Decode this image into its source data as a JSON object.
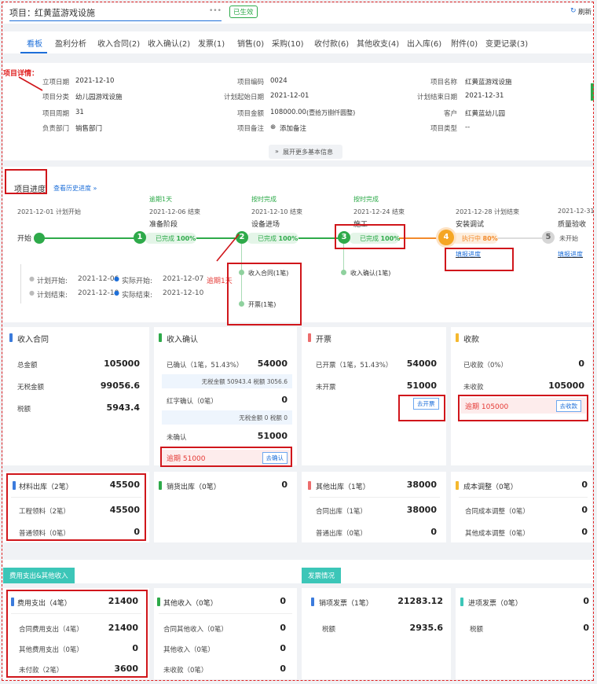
{
  "header": {
    "project_label": "项目：",
    "project_name": "红黄蓝游戏设施",
    "more": "•••",
    "status_badge": "已生效",
    "refresh": "刷新"
  },
  "tabs": [
    "看板",
    "盈利分析",
    "收入合同(2)",
    "收入确认(2)",
    "发票(1)",
    "销售(0)",
    "采购(10)",
    "收付款(6)",
    "其他收支(4)",
    "出入库(6)",
    "附件(0)",
    "变更记录(3)"
  ],
  "details": {
    "annotation": "项目详情：",
    "col1": [
      {
        "label": "立项日期",
        "value": "2021-12-10"
      },
      {
        "label": "项目分类",
        "value": "幼儿园游戏设施"
      },
      {
        "label": "项目周期",
        "value": "31"
      },
      {
        "label": "负责部门",
        "value": "销售部门"
      }
    ],
    "col2": [
      {
        "label": "项目编码",
        "value": "0024"
      },
      {
        "label": "计划起始日期",
        "value": "2021-12-01"
      },
      {
        "label": "项目金额",
        "value": "108000.00",
        "suffix": "(壹拾万捌仟圆整)"
      },
      {
        "label": "项目备注",
        "value": "添加备注"
      }
    ],
    "col3": [
      {
        "label": "项目名称",
        "value": "红黄蓝游戏设施"
      },
      {
        "label": "计划结束日期",
        "value": "2021-12-31"
      },
      {
        "label": "客户",
        "value": "红黄蓝幼儿园"
      },
      {
        "label": "项目类型",
        "value": "--"
      }
    ],
    "expand": "展开更多基本信息"
  },
  "progress": {
    "title": "项目进度",
    "history_link": "查看历史进度 »",
    "start_label": "开始",
    "start_date": "2021-12-01 计划开始",
    "stages": [
      {
        "num": "1",
        "top": "逾期1天",
        "date": "2021-12-06 结束",
        "name": "准备阶段",
        "state": "已完成",
        "pct": "100%"
      },
      {
        "num": "2",
        "top": "按时完成",
        "date": "2021-12-10 结束",
        "name": "设备进场",
        "state": "已完成",
        "pct": "100%"
      },
      {
        "num": "3",
        "top": "按时完成",
        "date": "2021-12-24 结束",
        "name": "施工",
        "state": "已完成",
        "pct": "100%"
      },
      {
        "num": "4",
        "top": "",
        "date": "2021-12-28 计划结束",
        "name": "安装调试",
        "state": "执行中",
        "pct": "80%",
        "link": "填报进度"
      },
      {
        "num": "5",
        "top": "",
        "date": "2021-12-31",
        "name": "质量验收",
        "state": "未开始",
        "pct": "",
        "link": "填报进度"
      }
    ],
    "sub2": [
      "收入合同(1笔)",
      "开票(1笔)"
    ],
    "sub3": [
      "收入确认(1笔)"
    ],
    "plan_start_label": "计划开始: ",
    "plan_start": "2021-12-06",
    "actual_start_label": "实际开始: ",
    "actual_start": "2021-12-07",
    "overdue": "逾期1天",
    "plan_end_label": "计划结束: ",
    "plan_end": "2021-12-10",
    "actual_end_label": "实际结束: ",
    "actual_end": "2021-12-10"
  },
  "cards_row1": {
    "contract": {
      "title": "收入合同",
      "rows": [
        {
          "l": "总金额",
          "v": "105000"
        },
        {
          "l": "无税金额",
          "v": "99056.6"
        },
        {
          "l": "税额",
          "v": "5943.4"
        }
      ]
    },
    "confirm": {
      "title": "收入确认",
      "r1l": "已确认（1笔，51.43%）",
      "r1v": "54000",
      "sub1": "无税金额 50943.4 税额 3056.6",
      "r2l": "红字确认（0笔）",
      "r2v": "0",
      "sub2": "无税金额 0 税额 0",
      "r3l": "未确认",
      "r3v": "51000",
      "overdue": "逾期 51000",
      "btn": "去确认"
    },
    "invoice": {
      "title": "开票",
      "r1l": "已开票（1笔，51.43%）",
      "r1v": "54000",
      "r2l": "未开票",
      "r2v": "51000",
      "btn": "去开票"
    },
    "receipt": {
      "title": "收款",
      "r1l": "已收款（0%）",
      "r1v": "0",
      "r2l": "未收款",
      "r2v": "105000",
      "overdue": "逾期 105000",
      "btn": "去收款"
    }
  },
  "cards_row2": {
    "material": {
      "title": "材料出库（2笔）",
      "v": "45500",
      "rows": [
        {
          "l": "工程领料（2笔）",
          "v": "45500"
        },
        {
          "l": "普通领料（0笔）",
          "v": "0"
        }
      ]
    },
    "sales_out": {
      "title": "销货出库（0笔）",
      "v": "0"
    },
    "other_out": {
      "title": "其他出库（1笔）",
      "v": "38000",
      "rows": [
        {
          "l": "合同出库（1笔）",
          "v": "38000"
        },
        {
          "l": "普通出库（0笔）",
          "v": "0"
        }
      ]
    },
    "cost_adj": {
      "title": "成本调整（0笔）",
      "v": "0",
      "rows": [
        {
          "l": "合同成本调整（0笔）",
          "v": "0"
        },
        {
          "l": "其他成本调整（0笔）",
          "v": "0"
        }
      ]
    }
  },
  "section_expense": "费用支出&其他收入",
  "section_invoice": "发票情况",
  "cards_row3": {
    "expense": {
      "title": "费用支出（4笔）",
      "v": "21400",
      "rows": [
        {
          "l": "合同费用支出（4笔）",
          "v": "21400"
        },
        {
          "l": "其他费用支出（0笔）",
          "v": "0"
        },
        {
          "l": "未付款（2笔）",
          "v": "3600"
        }
      ]
    },
    "other_income": {
      "title": "其他收入（0笔）",
      "v": "0",
      "rows": [
        {
          "l": "合同其他收入（0笔）",
          "v": "0"
        },
        {
          "l": "其他收入（0笔）",
          "v": "0"
        },
        {
          "l": "未收款（0笔）",
          "v": "0"
        }
      ]
    },
    "sales_inv": {
      "title": "销项发票（1笔）",
      "v": "21283.12",
      "rows": [
        {
          "l": "税额",
          "v": "2935.6"
        }
      ]
    },
    "input_inv": {
      "title": "进项发票（0笔）",
      "v": "0",
      "rows": [
        {
          "l": "税额",
          "v": "0"
        }
      ]
    }
  }
}
